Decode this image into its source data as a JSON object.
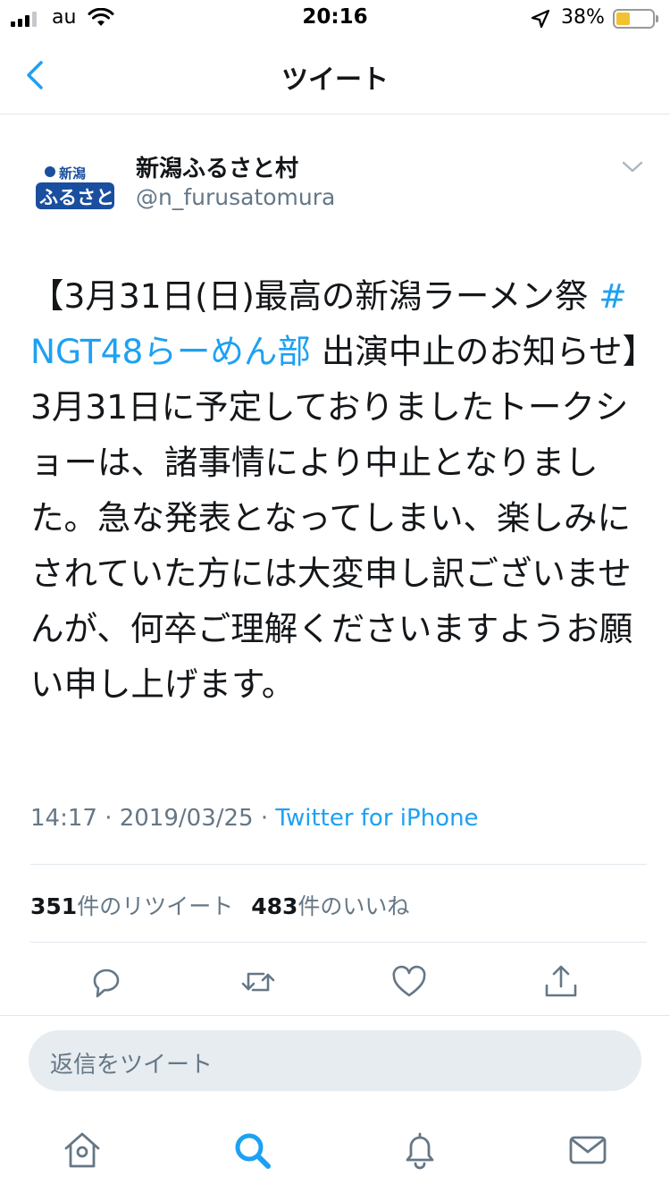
{
  "status_bar": {
    "carrier": "au",
    "time": "20:16",
    "battery_percent": "38%",
    "battery_level": 0.38,
    "icons": [
      "signal-icon",
      "wifi-icon",
      "location-arrow-icon",
      "battery-icon"
    ]
  },
  "header": {
    "title": "ツイート",
    "back_icon": "chevron-left-icon"
  },
  "tweet": {
    "author": {
      "display_name": "新潟ふるさと村",
      "handle": "@n_furusatomura",
      "avatar_logo_text": "新潟ふるさと村"
    },
    "text_before_hashtag": "【3月31日(日)最高の新潟ラーメン祭 ",
    "hashtag": "#NGT48らーめん部",
    "text_after_hashtag": " 出演中止のお知らせ】3月31日に予定しておりましたトークショーは、諸事情により中止となりました。急な発表となってしまい、楽しみにされていた方には大変申し訳ございませんが、何卒ご理解くださいますようお願い申し上げます。",
    "timestamp": "14:17 · 2019/03/25 ·",
    "source": "Twitter for iPhone",
    "stats": {
      "retweet_count": "351",
      "retweet_label": "件のリツイート",
      "like_count": "483",
      "like_label": "件のいいね"
    }
  },
  "actions": [
    "reply-icon",
    "retweet-icon",
    "like-icon",
    "share-icon"
  ],
  "reply_box": {
    "placeholder": "返信をツイート"
  },
  "tab_bar": [
    "home-icon",
    "search-icon",
    "notifications-icon",
    "messages-icon"
  ],
  "colors": {
    "accent": "#1da1f2",
    "secondary_text": "#657786",
    "primary_text": "#14171a",
    "divider": "#e1e8ed",
    "input_background": "#e6ecf0",
    "battery_fill": "#f2c230"
  }
}
